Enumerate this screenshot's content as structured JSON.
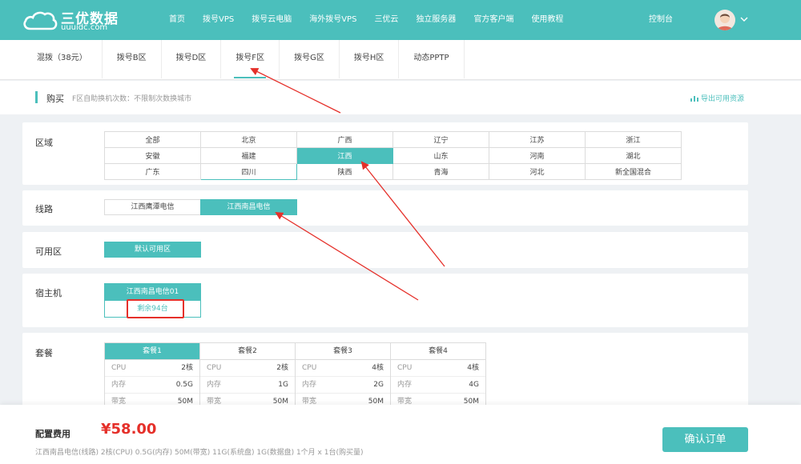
{
  "brand": {
    "title": "三优数据",
    "subtitle": "uuuidc.com"
  },
  "nav": [
    "首页",
    "拨号VPS",
    "拨号云电脑",
    "海外拨号VPS",
    "三优云",
    "独立服务器",
    "官方客户端",
    "使用教程"
  ],
  "console_label": "控制台",
  "tabs": [
    "混拨（38元）",
    "拨号B区",
    "拨号D区",
    "拨号F区",
    "拨号G区",
    "拨号H区",
    "动态PPTP"
  ],
  "active_tab": "拨号F区",
  "sub": {
    "title": "购买",
    "hint": "F区自助换机次数：不限制次数换城市",
    "export": "导出可用资源"
  },
  "region": {
    "label": "区域",
    "rows": [
      [
        "全部",
        "北京",
        "广西",
        "辽宁",
        "江苏",
        "浙江"
      ],
      [
        "安徽",
        "福建",
        "江西",
        "山东",
        "河南",
        "湖北"
      ],
      [
        "广东",
        "四川",
        "陕西",
        "青海",
        "河北",
        "新全国混合"
      ]
    ],
    "selected": "江西"
  },
  "line": {
    "label": "线路",
    "options": [
      "江西鹰潭电信",
      "江西南昌电信"
    ],
    "selected": "江西南昌电信"
  },
  "zone": {
    "label": "可用区",
    "option": "默认可用区"
  },
  "host": {
    "label": "宿主机",
    "name": "江西南昌电信01",
    "remaining": "剩余94台"
  },
  "package": {
    "label": "套餐",
    "selected": "套餐1",
    "items": [
      {
        "name": "套餐1",
        "specs": [
          [
            "CPU",
            "2核"
          ],
          [
            "内存",
            "0.5G"
          ],
          [
            "带宽",
            "50M"
          ]
        ]
      },
      {
        "name": "套餐2",
        "specs": [
          [
            "CPU",
            "2核"
          ],
          [
            "内存",
            "1G"
          ],
          [
            "带宽",
            "50M"
          ]
        ]
      },
      {
        "name": "套餐3",
        "specs": [
          [
            "CPU",
            "4核"
          ],
          [
            "内存",
            "2G"
          ],
          [
            "带宽",
            "50M"
          ]
        ]
      },
      {
        "name": "套餐4",
        "specs": [
          [
            "CPU",
            "4核"
          ],
          [
            "内存",
            "4G"
          ],
          [
            "带宽",
            "50M"
          ]
        ]
      }
    ]
  },
  "footer": {
    "fee_label": "配置费用",
    "price": "¥58.00",
    "summary": "江西南昌电信(线路) 2核(CPU) 0.5G(内存) 50M(带宽) 11G(系统盘) 1G(数据盘) 1个月 x 1台(购买量)",
    "confirm": "确认订单"
  },
  "colors": {
    "accent": "#4bbfbc",
    "price": "#e5302a",
    "annotation": "#e5302a"
  },
  "icons": [
    "cloud-logo-icon",
    "user-avatar-icon",
    "chevron-down-icon",
    "export-icon",
    "arrow-annotation"
  ]
}
